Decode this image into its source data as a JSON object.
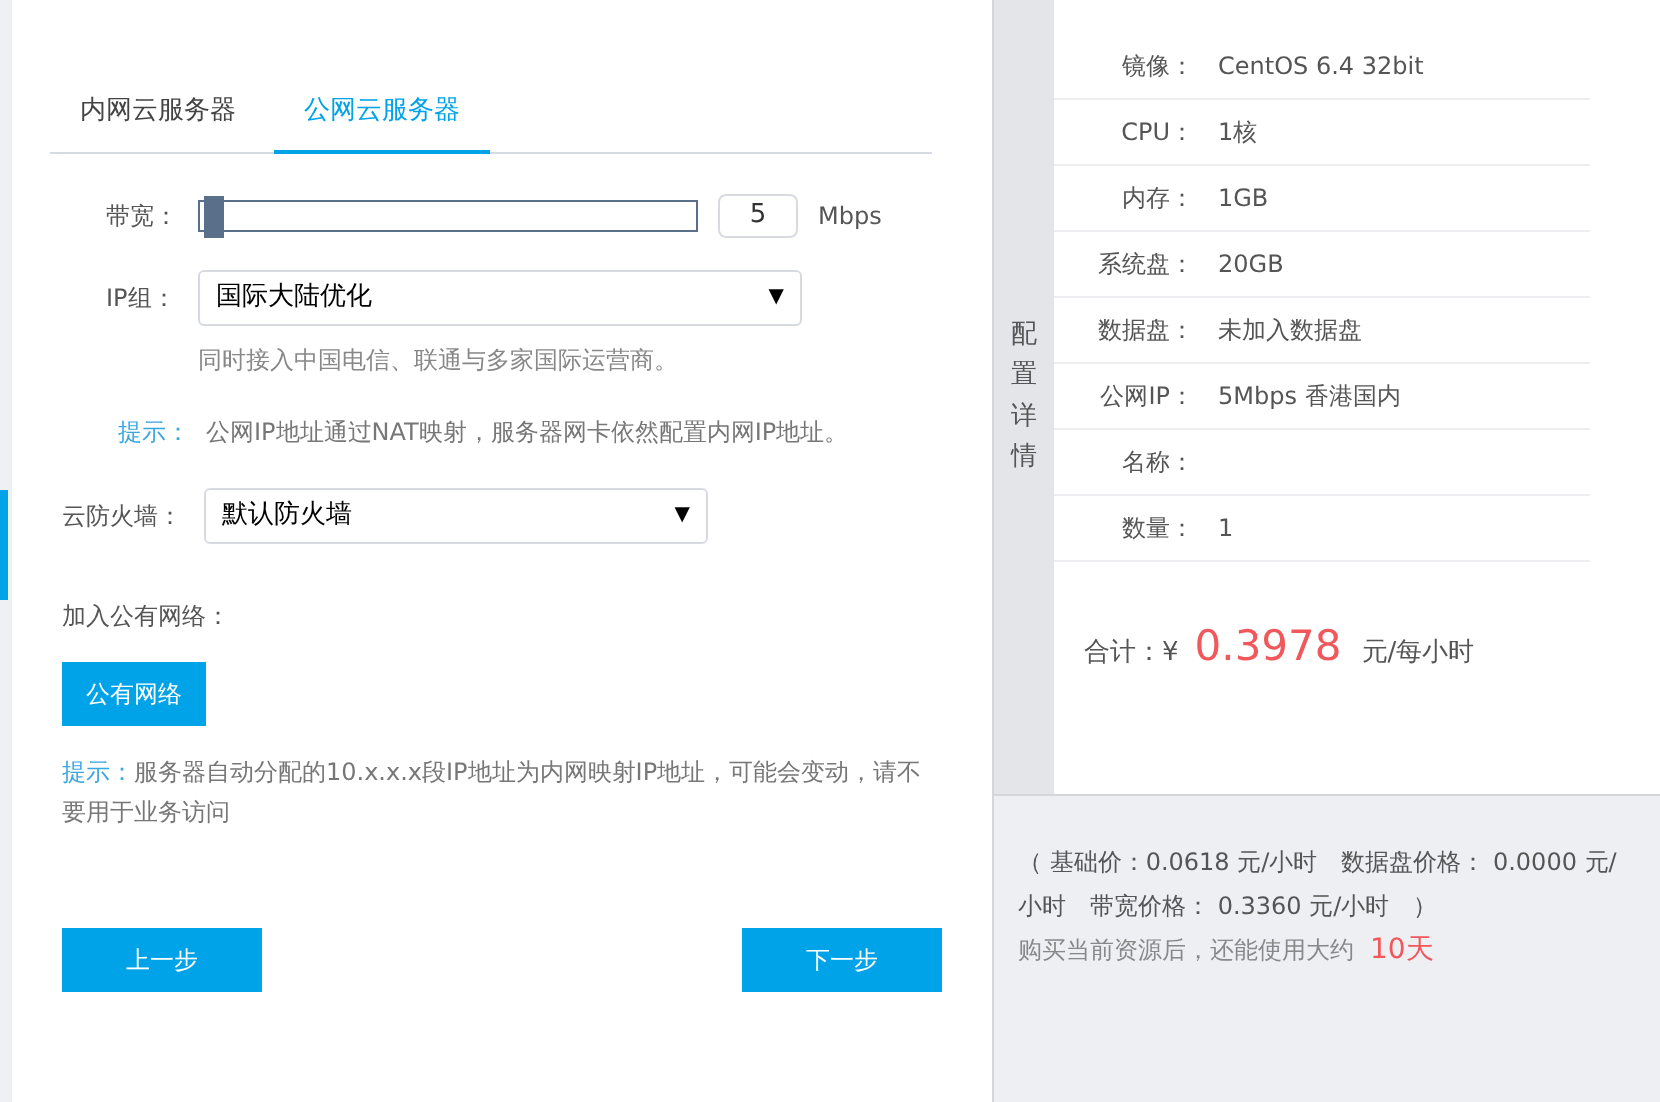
{
  "tabs": [
    {
      "label": "内网云服务器",
      "selected": false
    },
    {
      "label": "公网云服务器",
      "selected": true
    }
  ],
  "bandwidth": {
    "label": "带宽：",
    "level": 0.01,
    "value": "5",
    "unit": "Mbps"
  },
  "ip_group": {
    "label": "IP组：",
    "value": "国际大陆优化",
    "caret": "▼",
    "note": "同时接入中国电信、联通与多家国际运营商。"
  },
  "tip1": {
    "label": "提示：",
    "text": "公网IP地址通过NAT映射，服务器网卡依然配置内网IP地址。"
  },
  "firewall": {
    "label": "云防火墙：",
    "value": "默认防火墙",
    "caret": "▼"
  },
  "public_network": {
    "label": "加入公有网络：",
    "button": "公有网络"
  },
  "tip2": {
    "label": "提示：",
    "text": "服务器自动分配的10.x.x.x段IP地址为内网映射IP地址，可能会变动，请不要用于业务访问"
  },
  "buttons": [
    "上一步",
    "下一步"
  ],
  "details": {
    "tab": "配置详情",
    "rows": [
      {
        "label": "镜像：",
        "value": "CentOS 6.4 32bit"
      },
      {
        "label": "CPU：",
        "value": "1核"
      },
      {
        "label": "内存：",
        "value": "1GB"
      },
      {
        "label": "系统盘：",
        "value": "20GB"
      },
      {
        "label": "数据盘：",
        "value": "未加入数据盘"
      },
      {
        "label": "公网IP：",
        "value": "5Mbps 香港国内"
      },
      {
        "label": "名称：",
        "value": ""
      },
      {
        "label": "数量：",
        "value": "1"
      }
    ],
    "total": {
      "label": "合计：¥",
      "amount": "0.3978",
      "unit": "元/每小时"
    }
  },
  "price_breakdown": "（ 基础价：0.0618 元/小时　数据盘价格： 0.0000 元/小时　带宽价格： 0.3360 元/小时　）",
  "remaining": {
    "text": "购买当前资源后，还能使用大约",
    "days": "10天"
  }
}
